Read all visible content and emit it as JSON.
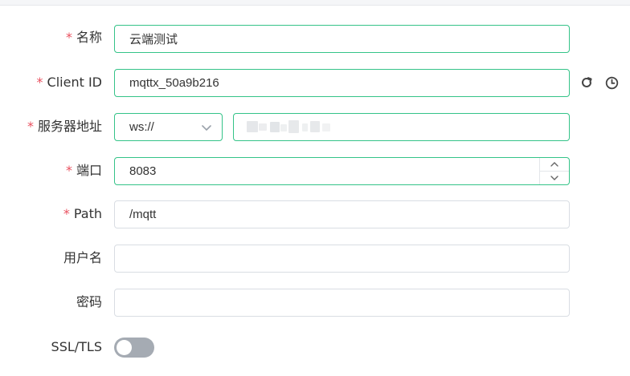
{
  "form": {
    "name": {
      "label": "名称",
      "required": true,
      "value": "云端测试"
    },
    "client_id": {
      "label": "Client ID",
      "required": true,
      "value": "mqttx_50a9b216"
    },
    "server": {
      "label": "服务器地址",
      "required": true,
      "protocol": "ws://",
      "host": ""
    },
    "port": {
      "label": "端口",
      "required": true,
      "value": "8083"
    },
    "path": {
      "label": "Path",
      "required": true,
      "value": "/mqtt"
    },
    "username": {
      "label": "用户名",
      "required": false,
      "value": ""
    },
    "password": {
      "label": "密码",
      "required": false,
      "value": ""
    },
    "ssl": {
      "label": "SSL/TLS",
      "enabled": false
    }
  },
  "required_mark": "*",
  "icons": {
    "refresh": "refresh-icon",
    "history": "clock-icon",
    "select": "chevron-down-icon",
    "step_up": "chevron-up-icon",
    "step_down": "chevron-down-icon"
  },
  "colors": {
    "active_border": "#34c388",
    "required": "#e9505f",
    "toggle_off": "#a5abb3"
  }
}
